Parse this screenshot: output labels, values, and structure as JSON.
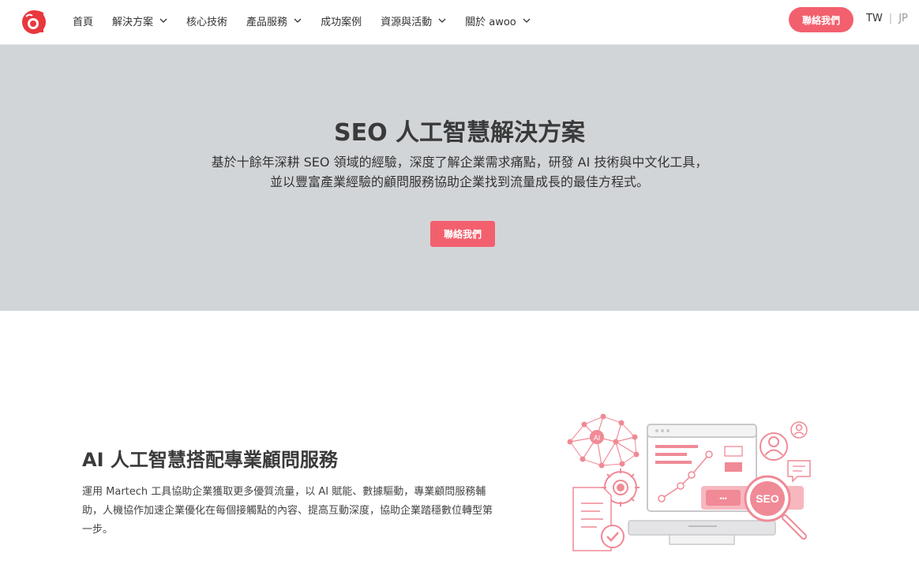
{
  "header": {
    "logo_letter": "a",
    "nav": [
      {
        "label": "首頁",
        "has_dropdown": false
      },
      {
        "label": "解決方案",
        "has_dropdown": true
      },
      {
        "label": "核心技術",
        "has_dropdown": false
      },
      {
        "label": "產品服務",
        "has_dropdown": true
      },
      {
        "label": "成功案例",
        "has_dropdown": false
      },
      {
        "label": "資源與活動",
        "has_dropdown": true
      },
      {
        "label": "關於 awoo",
        "has_dropdown": true
      }
    ],
    "contact_label": "聯絡我們",
    "lang_tw": "TW",
    "lang_sep": "|",
    "lang_jp": "JP"
  },
  "hero": {
    "title": "SEO 人工智慧解決方案",
    "desc_line1": "基於十餘年深耕 SEO 領域的經驗，深度了解企業需求痛點，研發 AI 技術與中文化工具，",
    "desc_line2": "並以豐富產業經驗的顧問服務協助企業找到流量成長的最佳方程式。",
    "button_label": "聯絡我們"
  },
  "section": {
    "title": "AI 人工智慧搭配專業顧問服務",
    "desc": "運用 Martech 工具協助企業獲取更多優質流量，以 AI 賦能、數據驅動，專業顧問服務輔助，人機協作加速企業優化在每個接觸點的內容、提高互動深度，協助企業踏穩數位轉型第一步。",
    "illustration_labels": {
      "ai": "AI",
      "seo": "SEO",
      "dots": "•••"
    }
  },
  "colors": {
    "accent": "#f2606e",
    "hero_bg": "#d2d5d8",
    "illus_pink": "#f08a96",
    "illus_gray": "#c9c9cc"
  }
}
